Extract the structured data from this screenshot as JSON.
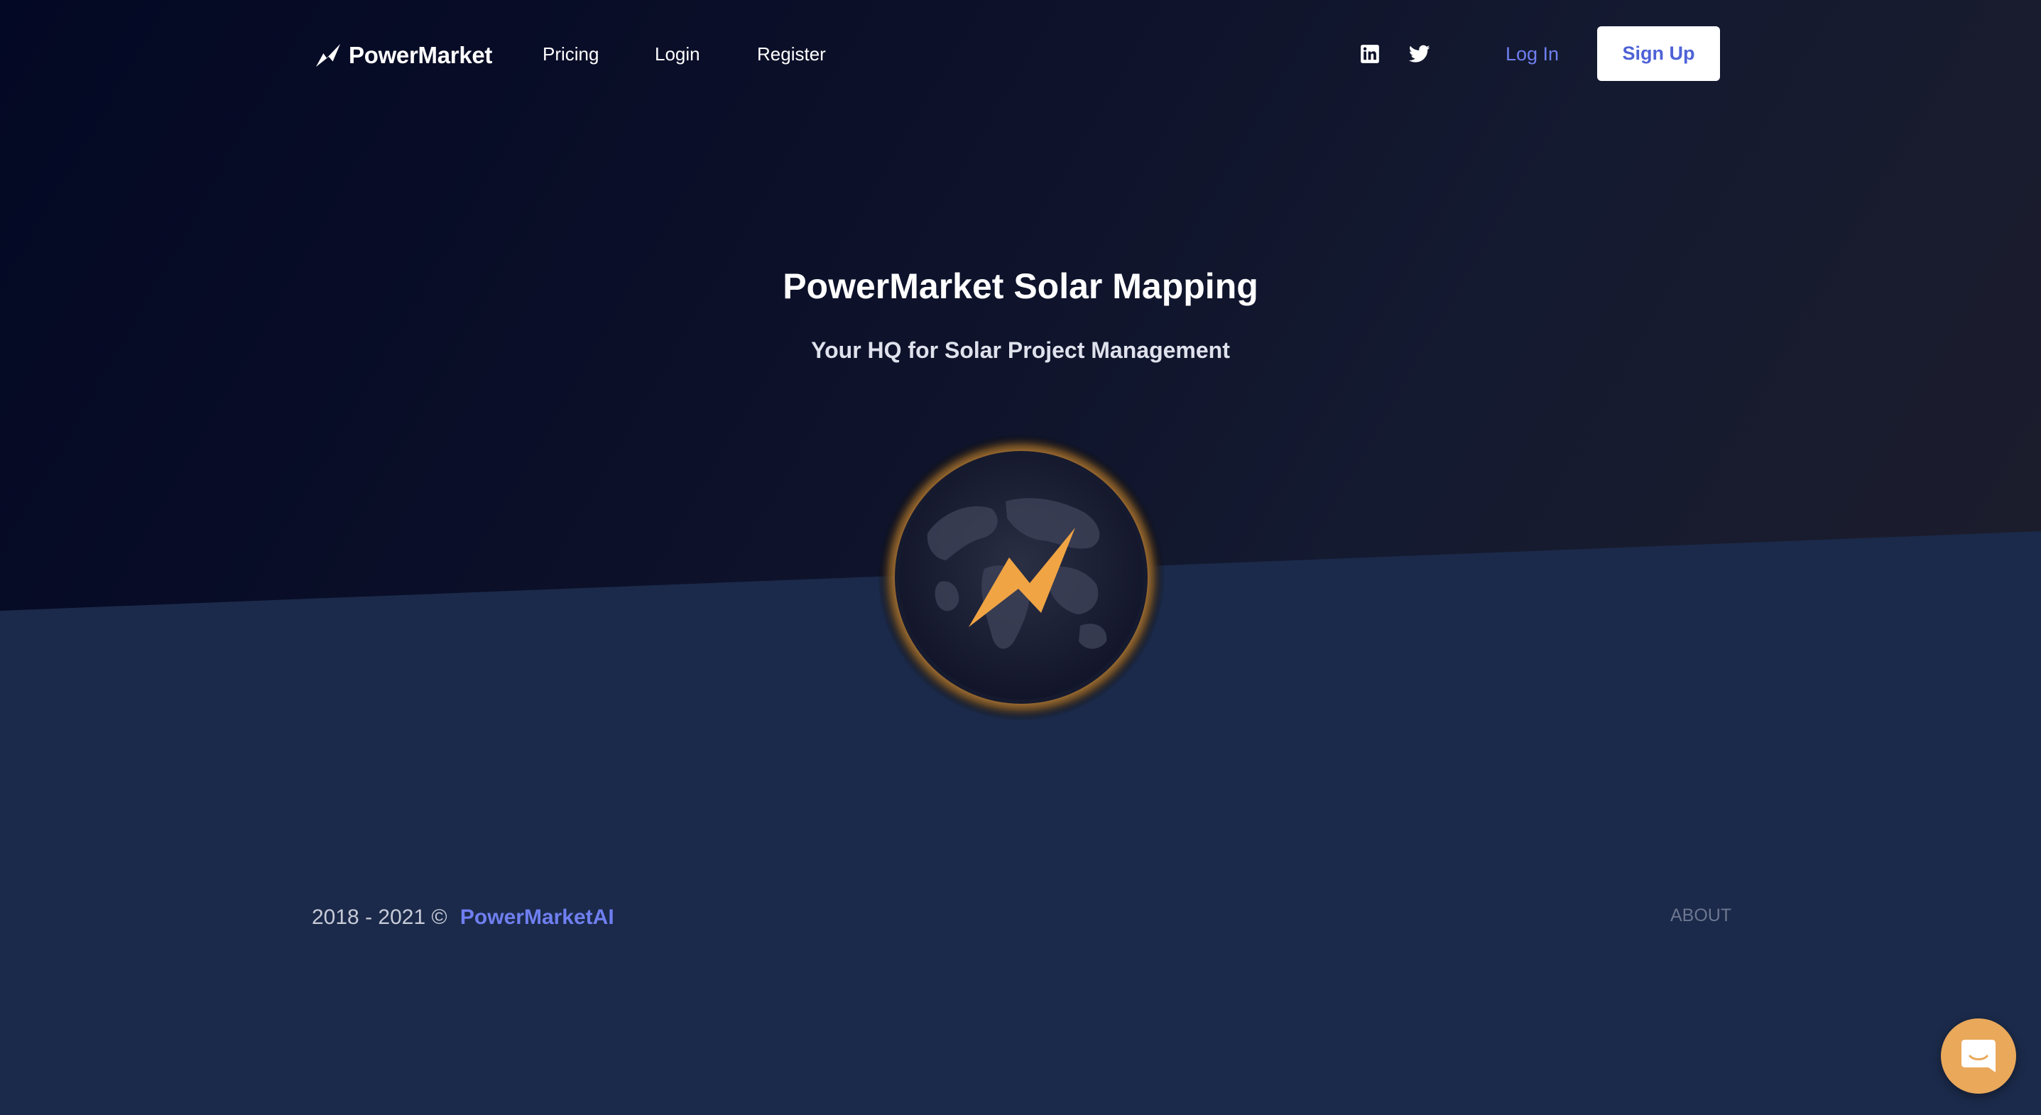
{
  "header": {
    "brand": "PowerMarket",
    "nav": [
      {
        "label": "Pricing"
      },
      {
        "label": "Login"
      },
      {
        "label": "Register"
      }
    ],
    "social": [
      {
        "icon": "linkedin-icon"
      },
      {
        "icon": "twitter-icon"
      }
    ],
    "login_label": "Log In",
    "signup_label": "Sign Up"
  },
  "hero": {
    "title": "PowerMarket Solar Mapping",
    "subtitle": "Your HQ for Solar Project Management",
    "emblem_icon": "globe-lightning-icon"
  },
  "footer": {
    "copyright": "2018 - 2021 ©",
    "brand_link": "PowerMarketAI",
    "about": "ABOUT"
  },
  "chat": {
    "icon": "chat-bubble-icon"
  },
  "colors": {
    "accent": "#6f7ff0",
    "signup_text": "#4e62d6",
    "bolt": "#f0a444",
    "chat_button": "#e9a85a",
    "background": "#1b2a4a"
  }
}
